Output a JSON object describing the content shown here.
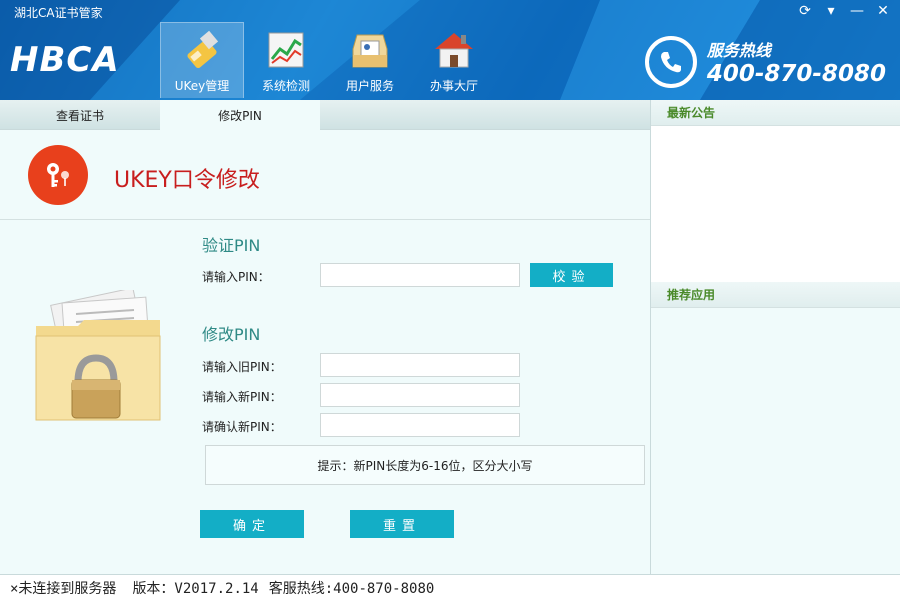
{
  "app": {
    "title": "湖北CA证书管家",
    "logo": "HBCA"
  },
  "window_controls": [
    {
      "icon": "refresh-icon",
      "glyph": "⟳"
    },
    {
      "icon": "menu-icon",
      "glyph": "▾"
    },
    {
      "icon": "minimize-icon",
      "glyph": "—"
    },
    {
      "icon": "close-icon",
      "glyph": "✕"
    }
  ],
  "nav": [
    {
      "label": "UKey管理",
      "icon": "ukey-icon",
      "active": true
    },
    {
      "label": "系统检测",
      "icon": "system-check-icon"
    },
    {
      "label": "用户服务",
      "icon": "user-service-icon"
    },
    {
      "label": "办事大厅",
      "icon": "service-hall-icon"
    }
  ],
  "hotline": {
    "label": "服务热线",
    "number": "400-870-8080"
  },
  "tabs": [
    {
      "label": "查看证书",
      "active": false
    },
    {
      "label": "修改PIN",
      "active": true
    }
  ],
  "section": {
    "title": "UKEY口令修改"
  },
  "verify": {
    "title": "验证PIN",
    "pin_label": "请输入PIN：",
    "pin_value": "",
    "verify_button": "校验"
  },
  "change": {
    "title": "修改PIN",
    "old_label": "请输入旧PIN：",
    "new_label": "请输入新PIN：",
    "confirm_label": "请确认新PIN：",
    "old_value": "",
    "new_value": "",
    "confirm_value": "",
    "hint": "提示：新PIN长度为6-16位，区分大小写",
    "ok_button": "确定",
    "reset_button": "重置"
  },
  "side": {
    "announcements": "最新公告",
    "recommended": "推荐应用"
  },
  "status": {
    "connection": "×未连接到服务器",
    "version": "版本：V2017.2.14",
    "support": "客服热线:400-870-8080"
  },
  "colors": {
    "header": "#1577c7",
    "accent": "#13aec6",
    "title_red": "#c81e1e",
    "key_bg": "#e8401c"
  }
}
